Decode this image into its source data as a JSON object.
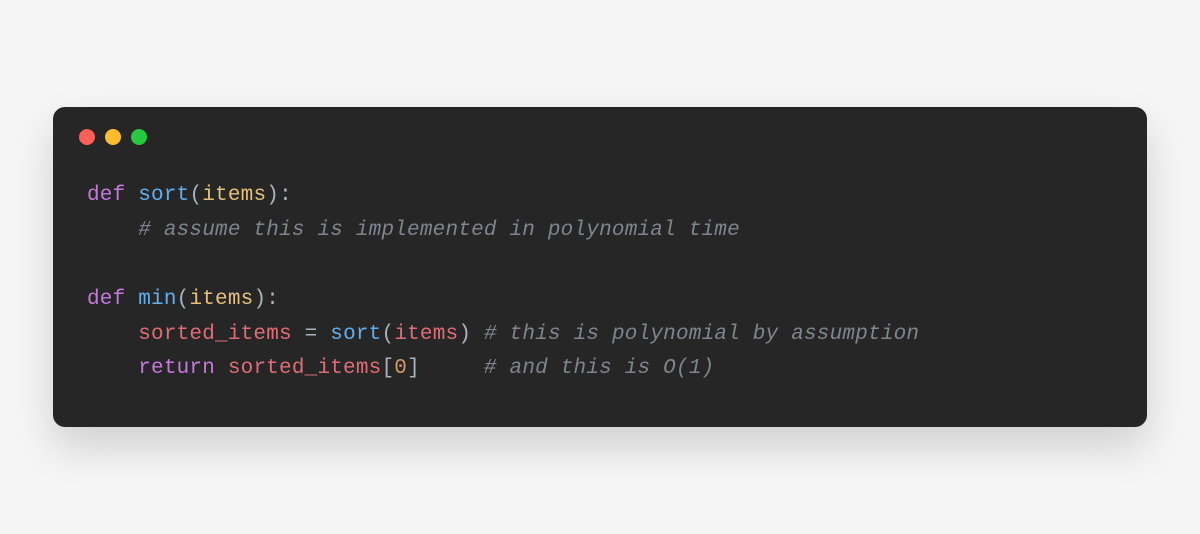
{
  "colors": {
    "bg": "#262626",
    "keyword": "#c678dd",
    "function": "#61afef",
    "param": "#e5c07b",
    "comment": "#7f848e",
    "identifier": "#e06c75",
    "number": "#d19a66",
    "default": "#abb2bf"
  },
  "lines": {
    "l1": {
      "def": "def",
      "sp1": " ",
      "fn": "sort",
      "lp": "(",
      "param": "items",
      "rp": ")",
      "colon": ":"
    },
    "l2": {
      "indent": "    ",
      "comment": "# assume this is implemented in polynomial time"
    },
    "l3": "",
    "l4": {
      "def": "def",
      "sp1": " ",
      "fn": "min",
      "lp": "(",
      "param": "items",
      "rp": ")",
      "colon": ":"
    },
    "l5": {
      "indent": "    ",
      "var": "sorted_items",
      "sp1": " ",
      "eq": "=",
      "sp2": " ",
      "fn": "sort",
      "lp": "(",
      "arg": "items",
      "rp": ")",
      "sp3": " ",
      "comment": "# this is polynomial by assumption"
    },
    "l6": {
      "indent": "    ",
      "kw": "return",
      "sp1": " ",
      "var": "sorted_items",
      "lb": "[",
      "idx": "0",
      "rb": "]",
      "pad": "     ",
      "comment": "# and this is O(1)"
    }
  }
}
